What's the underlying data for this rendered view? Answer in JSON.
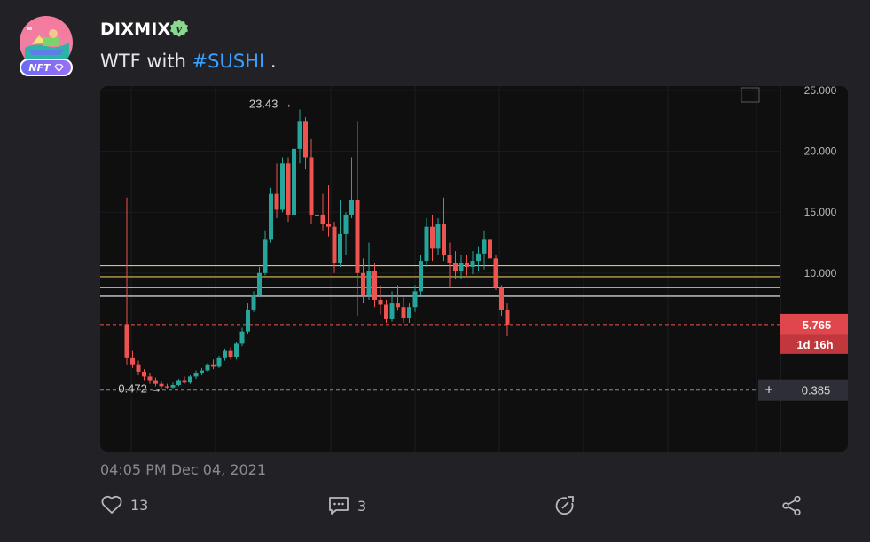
{
  "post": {
    "username": "DIXMIX",
    "verified_badge_letter": "v",
    "nft_badge_label": "NFT",
    "text_prefix": "WTF with ",
    "hashtag": "#SUSHI",
    "text_suffix": " .",
    "timestamp": "04:05 PM Dec 04, 2021"
  },
  "actions": {
    "like_count": "13",
    "comment_count": "3"
  },
  "colors": {
    "up": "#26a69a",
    "down": "#ef5350",
    "hashtag": "#3aa0ff",
    "level_line": "#d9c35a",
    "price_tag": "#e0474c"
  },
  "chart_data": {
    "type": "candlestick",
    "ylim": [
      0,
      25.5
    ],
    "y_ticks": [
      "25.000",
      "20.000",
      "15.000",
      "10.000"
    ],
    "annotations": {
      "high_label": "23.43",
      "low_label": "0.472"
    },
    "price_tag": {
      "value": "5.765",
      "countdown": "1d 16h"
    },
    "crosshair_label": "0.385",
    "horizontal_levels": [
      10.6,
      9.7,
      8.8
    ],
    "grey_level": 8.1,
    "current_price": 5.765,
    "low_dashed_level": 0.385,
    "candles": [
      [
        5.8,
        16.2,
        2.5,
        3.0
      ],
      [
        3.0,
        3.6,
        2.2,
        2.5
      ],
      [
        2.5,
        2.8,
        1.6,
        1.9
      ],
      [
        1.9,
        2.1,
        1.2,
        1.5
      ],
      [
        1.5,
        1.8,
        0.9,
        1.2
      ],
      [
        1.2,
        1.4,
        0.7,
        0.9
      ],
      [
        0.9,
        1.1,
        0.5,
        0.7
      ],
      [
        0.7,
        0.9,
        0.472,
        0.6
      ],
      [
        0.6,
        1.0,
        0.5,
        0.8
      ],
      [
        0.8,
        1.3,
        0.7,
        1.2
      ],
      [
        1.2,
        1.5,
        0.9,
        1.0
      ],
      [
        1.0,
        1.6,
        0.9,
        1.5
      ],
      [
        1.5,
        2.0,
        1.3,
        1.8
      ],
      [
        1.8,
        2.2,
        1.6,
        2.0
      ],
      [
        2.0,
        2.6,
        1.9,
        2.5
      ],
      [
        2.5,
        2.9,
        2.1,
        2.3
      ],
      [
        2.3,
        3.2,
        2.2,
        3.0
      ],
      [
        3.0,
        3.8,
        2.8,
        3.6
      ],
      [
        3.6,
        3.9,
        2.9,
        3.1
      ],
      [
        3.1,
        4.3,
        2.9,
        4.2
      ],
      [
        4.2,
        5.5,
        4.0,
        5.2
      ],
      [
        5.2,
        7.5,
        5.0,
        7.0
      ],
      [
        7.0,
        8.5,
        6.8,
        8.2
      ],
      [
        8.2,
        10.5,
        8.0,
        10.0
      ],
      [
        10.0,
        13.5,
        9.8,
        12.8
      ],
      [
        12.8,
        17.0,
        12.5,
        16.5
      ],
      [
        16.5,
        19.0,
        14.5,
        15.2
      ],
      [
        15.2,
        19.5,
        15.0,
        19.0
      ],
      [
        19.0,
        19.5,
        14.2,
        14.8
      ],
      [
        14.8,
        20.8,
        14.5,
        20.2
      ],
      [
        20.2,
        23.43,
        19.0,
        22.5
      ],
      [
        22.5,
        22.8,
        18.5,
        19.5
      ],
      [
        19.5,
        21.0,
        14.0,
        14.8
      ],
      [
        14.8,
        18.5,
        13.0,
        14.8
      ],
      [
        14.8,
        16.5,
        13.5,
        14.0
      ],
      [
        14.0,
        17.2,
        13.0,
        13.8
      ],
      [
        13.8,
        14.2,
        10.0,
        10.8
      ],
      [
        10.8,
        16.0,
        10.5,
        13.2
      ],
      [
        13.2,
        15.0,
        11.5,
        14.8
      ],
      [
        14.8,
        19.5,
        14.5,
        16.0
      ],
      [
        16.0,
        22.5,
        6.5,
        10.0
      ],
      [
        10.0,
        11.2,
        7.5,
        8.2
      ],
      [
        8.2,
        12.5,
        7.8,
        10.2
      ],
      [
        10.2,
        10.8,
        7.2,
        7.8
      ],
      [
        7.8,
        9.0,
        6.6,
        7.4
      ],
      [
        7.4,
        7.8,
        5.9,
        6.2
      ],
      [
        6.2,
        8.5,
        6.0,
        7.5
      ],
      [
        7.5,
        9.0,
        6.9,
        7.2
      ],
      [
        7.2,
        8.0,
        5.9,
        6.3
      ],
      [
        6.3,
        7.5,
        5.9,
        7.2
      ],
      [
        7.2,
        9.0,
        6.8,
        8.5
      ],
      [
        8.5,
        11.5,
        8.2,
        11.0
      ],
      [
        11.0,
        14.5,
        10.5,
        13.8
      ],
      [
        13.8,
        14.8,
        11.0,
        12.0
      ],
      [
        12.0,
        14.5,
        11.5,
        14.0
      ],
      [
        14.0,
        16.2,
        11.0,
        11.5
      ],
      [
        11.5,
        12.5,
        8.8,
        10.8
      ],
      [
        10.8,
        11.8,
        9.5,
        10.2
      ],
      [
        10.2,
        11.5,
        9.5,
        10.8
      ],
      [
        10.8,
        11.5,
        9.8,
        10.5
      ],
      [
        10.5,
        11.8,
        9.9,
        11.0
      ],
      [
        11.0,
        12.2,
        10.2,
        11.6
      ],
      [
        11.6,
        13.5,
        10.3,
        12.8
      ],
      [
        12.8,
        13.0,
        10.6,
        11.2
      ],
      [
        11.2,
        11.5,
        8.6,
        8.8
      ],
      [
        8.8,
        9.0,
        6.5,
        7.0
      ],
      [
        7.0,
        7.5,
        4.8,
        5.765
      ]
    ]
  }
}
